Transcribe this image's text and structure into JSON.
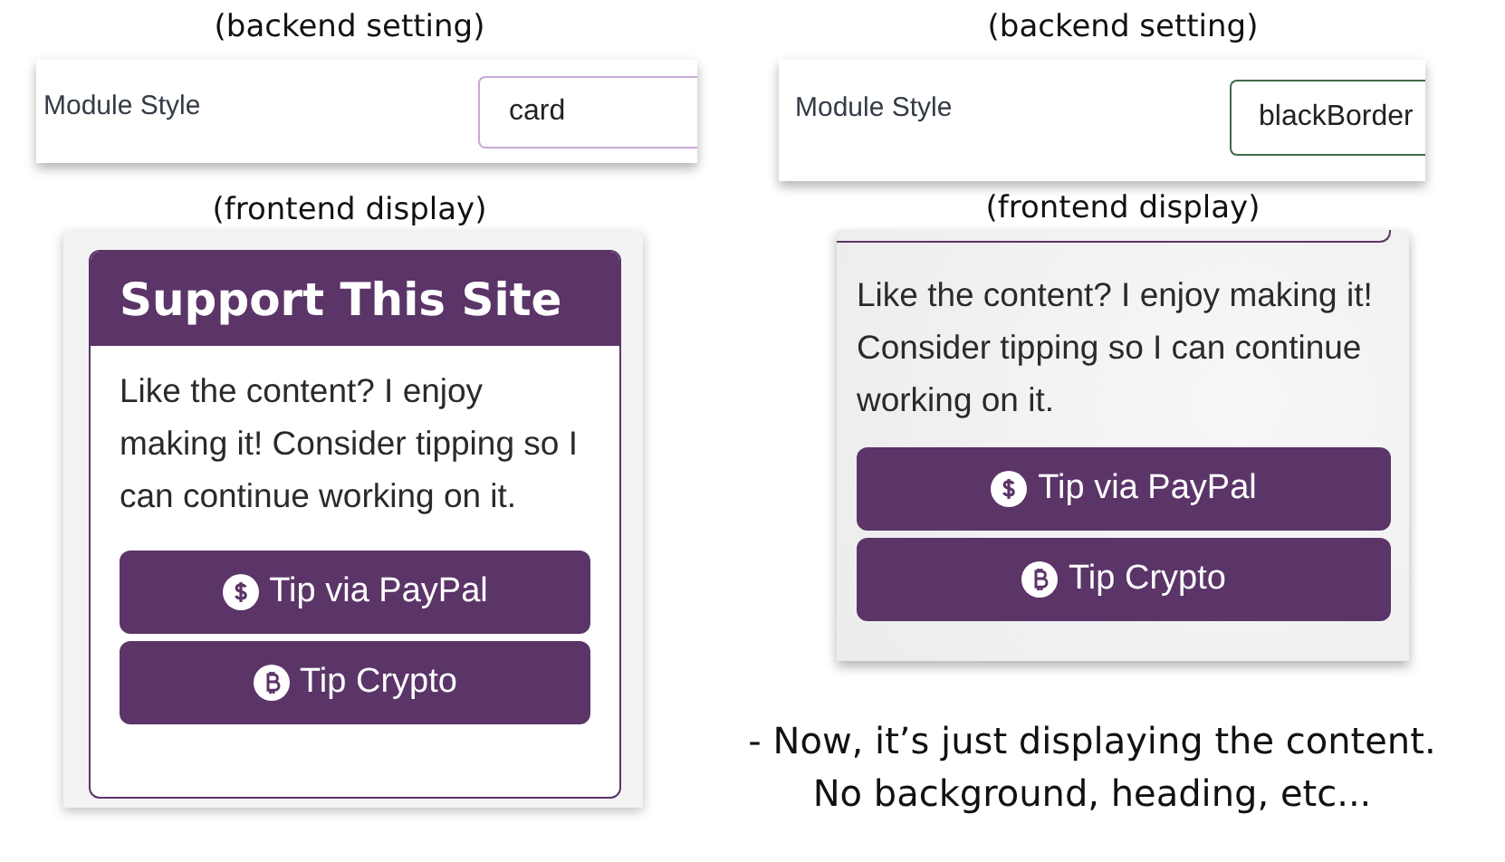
{
  "panels": [
    {
      "backend_caption": "(backend setting)",
      "setting": {
        "label": "Module Style",
        "value": "card"
      },
      "frontend_caption": "(frontend display)",
      "module": {
        "kind": "card",
        "heading": "Support This Site",
        "text": "Like the content? I enjoy making it! Consider tipping so I can continue working on it.",
        "buttons": [
          {
            "kind": "dollar",
            "label": "Tip via PayPal"
          },
          {
            "kind": "bitcoin",
            "label": "Tip Crypto"
          }
        ]
      }
    },
    {
      "backend_caption": "(backend setting)",
      "setting": {
        "label": "Module Style",
        "value": "blackBorder"
      },
      "frontend_caption": "(frontend display)",
      "module": {
        "kind": "plain",
        "text": "Like the content? I enjoy making it! Consider tipping so I can continue working on it.",
        "buttons": [
          {
            "kind": "dollar",
            "label": "Tip via PayPal"
          },
          {
            "kind": "bitcoin",
            "label": "Tip Crypto"
          }
        ]
      }
    }
  ],
  "note": [
    "- Now, it’s just displaying the content.",
    "No background, heading, etc..."
  ]
}
